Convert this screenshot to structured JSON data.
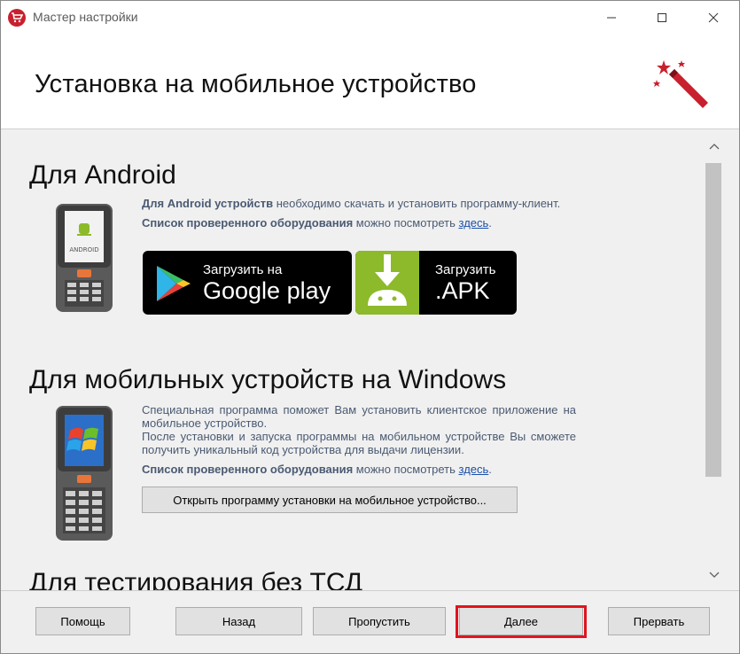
{
  "window": {
    "title": "Мастер настройки",
    "controls": [
      "minimize-icon",
      "maximize-icon",
      "close-icon"
    ]
  },
  "header": {
    "title": "Установка на мобильное устройство",
    "icon": "magic-wand-icon"
  },
  "android": {
    "title": "Для Android",
    "line1_bold": "Для Android устройств",
    "line1_rest": " необходимо скачать и установить программу-клиент.",
    "line2_bold": "Список проверенного оборудования",
    "line2_rest": " можно посмотреть ",
    "link": "здесь",
    "link_tail": ".",
    "screen_text": "ANDROID",
    "google_play": {
      "small": "Загрузить на",
      "big": "Google play"
    },
    "apk": {
      "small": "Загрузить",
      "big": ".APK"
    }
  },
  "windows": {
    "title": "Для мобильных устройств на Windows",
    "para1": "Специальная программа поможет Вам установить клиентское приложение на мобильное устройство.",
    "para2": "После установки и запуска программы на мобильном устройстве Вы сможете получить уникальный код устройства для выдачи лицензии.",
    "line3_bold": "Список проверенного оборудования",
    "line3_rest": " можно посмотреть ",
    "link": "здесь",
    "link_tail": ".",
    "install_button": "Открыть программу установки на мобильное устройство..."
  },
  "testing": {
    "title": "Для тестирования без ТСД"
  },
  "footer": {
    "help": "Помощь",
    "back": "Назад",
    "skip": "Пропустить",
    "next": "Далее",
    "cancel": "Прервать"
  },
  "colors": {
    "accent_red": "#c8202e",
    "highlight": "#e0141e",
    "android_green": "#8cba2a",
    "link": "#1a4fa8"
  }
}
